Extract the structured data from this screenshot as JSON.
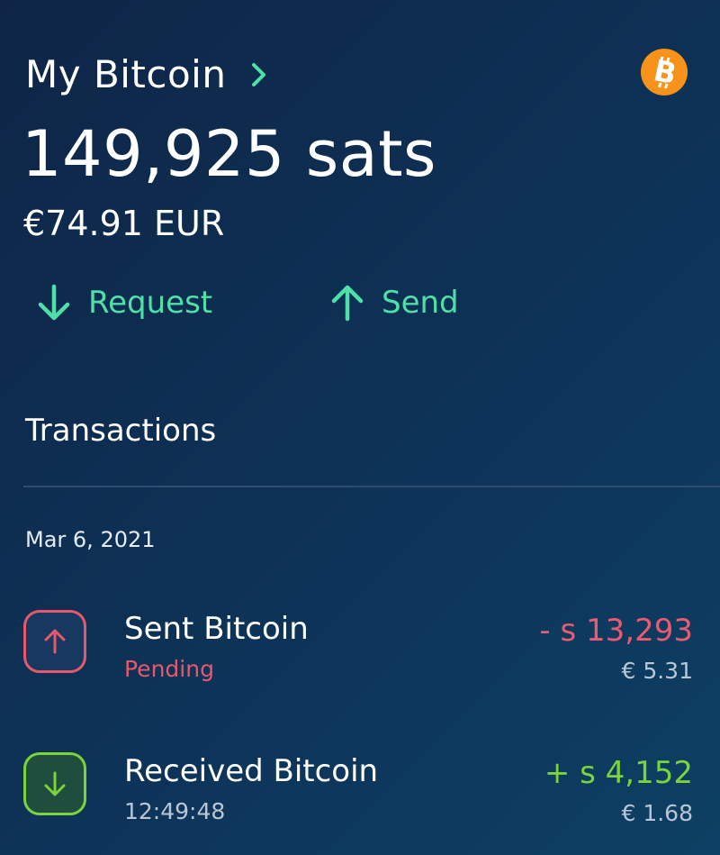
{
  "header": {
    "title": "My Bitcoin",
    "chevron_icon": "chevron-right-icon",
    "logo_icon": "bitcoin-logo-icon"
  },
  "balance": {
    "sats": "149,925 sats",
    "fiat": "€74.91 EUR"
  },
  "actions": {
    "request": {
      "label": "Request",
      "icon": "arrow-down-icon"
    },
    "send": {
      "label": "Send",
      "icon": "arrow-up-icon"
    }
  },
  "transactions": {
    "heading": "Transactions",
    "groups": [
      {
        "date": "Mar 6, 2021",
        "items": [
          {
            "title": "Sent Bitcoin",
            "status": "Pending",
            "amount": "- s 13,293",
            "fiat": "€ 5.31",
            "icon": "arrow-up-icon"
          },
          {
            "title": "Received Bitcoin",
            "status": "12:49:48",
            "amount": "+ s 4,152",
            "fiat": "€ 1.68",
            "icon": "arrow-down-icon"
          }
        ]
      }
    ]
  },
  "colors": {
    "accent": "#4ee0a8",
    "negative": "#ea5a70",
    "positive": "#7ad43a",
    "bitcoin_orange": "#f7931a"
  }
}
